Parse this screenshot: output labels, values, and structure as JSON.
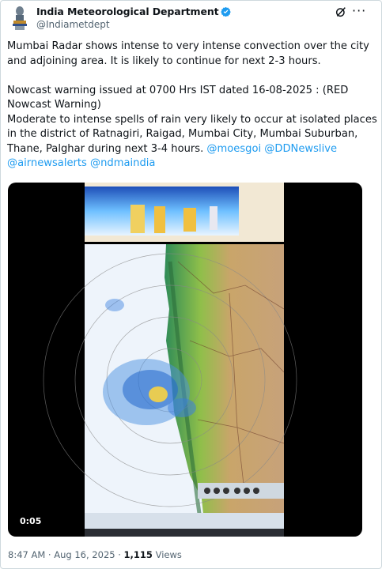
{
  "account": {
    "name": "India Meteorological Department",
    "handle": "@Indiametdept"
  },
  "icons": [
    "imd-emblem",
    "verified-badge",
    "grok-icon",
    "more-icon"
  ],
  "colors": {
    "link": "#1d9bf0",
    "verified": "#1d9bf0",
    "muted": "#536471"
  },
  "tweet": {
    "line1": "Mumbai Radar shows intense to very intense convection over the city",
    "line2": "and adjoining area. It is likely to continue for next 2-3 hours.",
    "line3": "Nowcast warning issued at 0700 Hrs IST dated 16-08-2025 : (RED",
    "line4": "Nowcast  Warning)",
    "line5": "Moderate to intense spells of rain  very likely to occur at isolated places",
    "line6": "in the district of Ratnagiri, Raigad, Mumbai City, Mumbai Suburban,",
    "line7": "Thane, Palghar during next 3-4 hours.",
    "mention1": "@moesgoi",
    "mention2": "@DDNewslive",
    "mention3": "@airnewsalerts",
    "mention4": "@ndmaindia"
  },
  "video": {
    "elapsed": "0:05"
  },
  "footer": {
    "time": "8:47 AM",
    "sep": " · ",
    "date": "Aug 16, 2025",
    "sep2": " · ",
    "views_count": "1,115",
    "views_label": " Views"
  }
}
